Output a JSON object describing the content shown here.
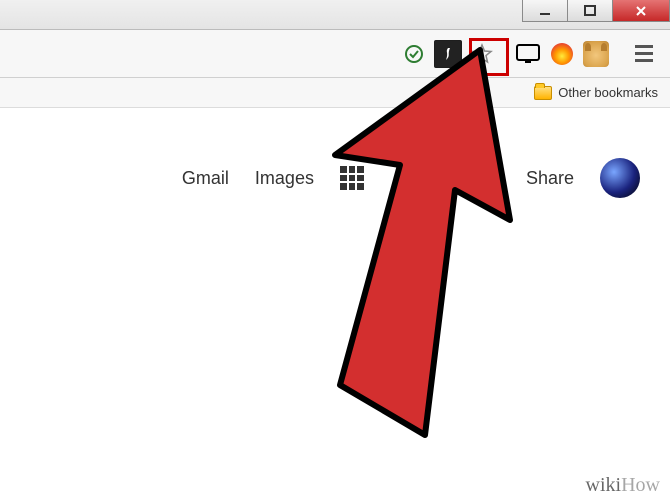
{
  "window": {
    "minimize": "Minimize",
    "maximize": "Maximize",
    "close": "Close"
  },
  "toolbar": {
    "secure_icon": "secure-ok",
    "flash_icon": "flash-player",
    "star_icon": "bookmark-star",
    "cast_icon": "cast",
    "flame_icon": "flame-extension",
    "doge_icon": "doge-extension",
    "menu_icon": "menu"
  },
  "bookmarks": {
    "other_label": "Other bookmarks"
  },
  "google_row": {
    "gmail": "Gmail",
    "images": "Images",
    "share": "Share"
  },
  "watermark": {
    "prefix": "wiki",
    "suffix": "How"
  }
}
